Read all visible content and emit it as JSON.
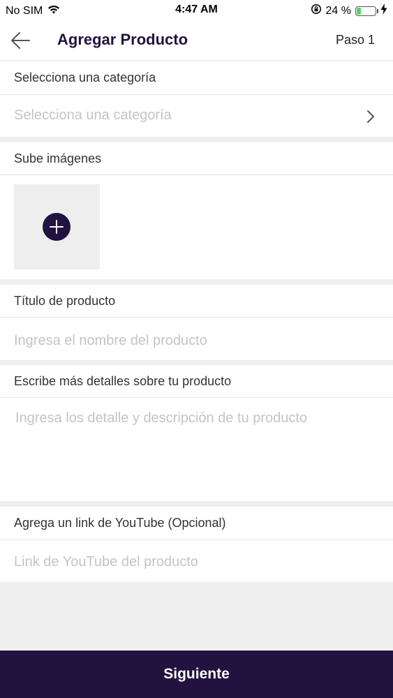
{
  "status_bar": {
    "carrier": "No SIM",
    "time": "4:47 AM",
    "battery_percent": "24 %",
    "battery_level": 0.24,
    "icons": [
      "wifi-icon",
      "rotation-lock-icon",
      "battery-icon",
      "charging-bolt-icon"
    ]
  },
  "header": {
    "back_icon": "arrow-left-icon",
    "title": "Agregar Producto",
    "step": "Paso 1"
  },
  "category": {
    "label": "Selecciona una categoría",
    "placeholder": "Selecciona una categoría",
    "icon": "chevron-right-icon"
  },
  "images": {
    "label": "Sube imágenes",
    "add_icon": "plus-circle-icon"
  },
  "title_field": {
    "label": "Título de producto",
    "placeholder": "Ingresa el nombre del producto"
  },
  "details_field": {
    "label": "Escribe más detalles sobre tu producto",
    "placeholder": "Ingresa los detalle y descripción de tu producto"
  },
  "youtube_field": {
    "label": "Agrega un link de YouTube (Opcional)",
    "placeholder": "Link de YouTube del producto"
  },
  "footer": {
    "next_label": "Siguiente"
  },
  "colors": {
    "primary": "#22123f",
    "placeholder": "#c4c4c9",
    "background": "#efefef",
    "battery_green": "#4cd964"
  }
}
